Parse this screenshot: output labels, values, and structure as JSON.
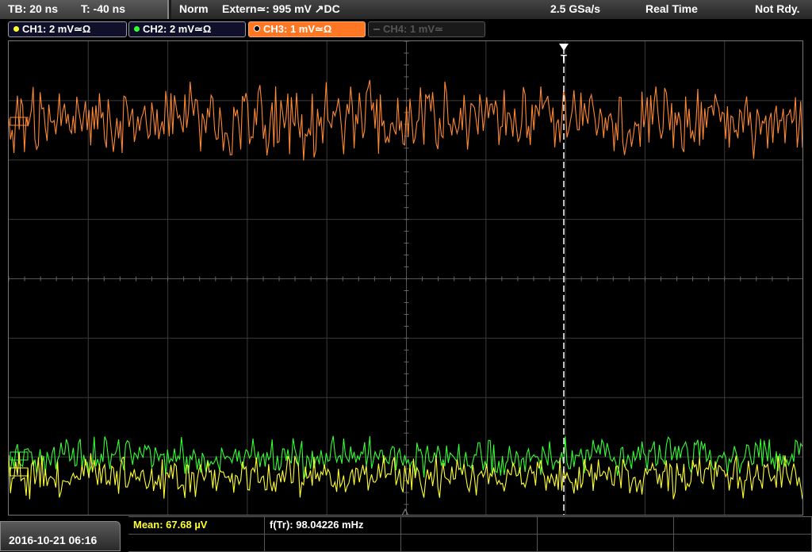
{
  "topbar": {
    "timebase": "TB: 20 ns",
    "time_offset": "T: -40 ns",
    "trigger_mode": "Norm",
    "trigger_source": "Extern≃: 995 mV ↗DC",
    "sample_rate": "2.5 GSa/s",
    "acq_mode": "Real Time",
    "status": "Not Rdy."
  },
  "channels": [
    {
      "label": "CH1: 2 mV≃Ω",
      "color": "#ffff33",
      "active": true
    },
    {
      "label": "CH2: 2 mV≃Ω",
      "color": "#33ff33",
      "active": true
    },
    {
      "label": "CH3: 1 mV≃Ω",
      "color": "#ff8833",
      "active": true,
      "selected": true
    },
    {
      "label": "CH4: 1 mV≃",
      "color": "#555555",
      "active": false
    }
  ],
  "trigger_marker": "T",
  "bottombar": {
    "datetime": "2016-10-21 06:16",
    "measurements": [
      {
        "label": "Mean: 67.68 µV",
        "color": "#ffff33"
      },
      {
        "label": "f(Tr): 98.04226 mHz",
        "color": "#ffffff"
      }
    ]
  },
  "colors": {
    "ch1": "#ffff33",
    "ch2": "#33ff33",
    "ch3": "#ff8833",
    "grid": "#3a3a3a",
    "ch3_tab_bg": "#ff7722"
  }
}
